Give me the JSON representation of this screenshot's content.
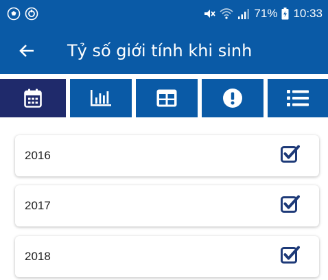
{
  "status_bar": {
    "left_icons": [
      "soccer-ball-icon",
      "sync-circle-icon"
    ],
    "right_icons": [
      "mute-icon",
      "wifi-icon",
      "signal-icon",
      "battery-icon"
    ],
    "battery": "71%",
    "time": "10:33"
  },
  "app_bar": {
    "back_icon": "arrow-left-icon",
    "title": "Tỷ số giới tính khi sinh"
  },
  "tabs": [
    {
      "icon": "calendar-icon",
      "active": true
    },
    {
      "icon": "bar-chart-icon",
      "active": false
    },
    {
      "icon": "table-icon",
      "active": false
    },
    {
      "icon": "alert-circle-icon",
      "active": false
    },
    {
      "icon": "list-icon",
      "active": false
    }
  ],
  "years": [
    {
      "label": "2016",
      "checked": true
    },
    {
      "label": "2017",
      "checked": true
    },
    {
      "label": "2018",
      "checked": true
    }
  ],
  "colors": {
    "primary": "#0a5aa6",
    "active_tab": "#1f2a6b",
    "checkbox": "#1e3a78"
  }
}
